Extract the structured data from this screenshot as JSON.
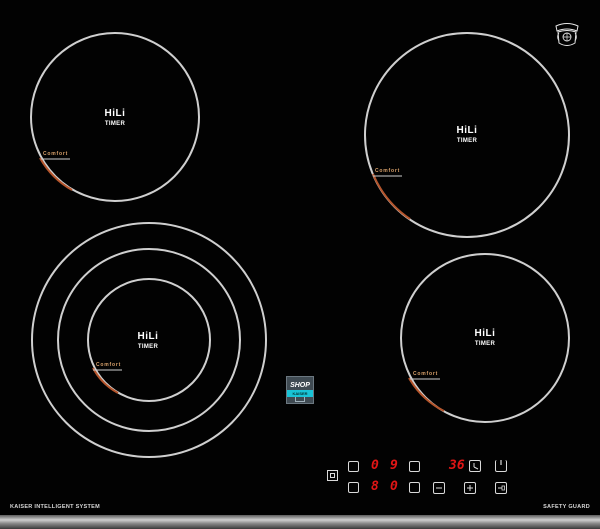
{
  "zones": [
    {
      "brand": "HiLi",
      "sub": "TIMER",
      "comfort": "Comfort"
    },
    {
      "brand": "HiLi",
      "sub": "TIMER",
      "comfort": "Comfort"
    },
    {
      "brand": "HiLi",
      "sub": "TIMER",
      "comfort": "Comfort"
    },
    {
      "brand": "HiLi",
      "sub": "TIMER",
      "comfort": "Comfort"
    }
  ],
  "logo": {
    "text": "Kaiser",
    "icon": "kaiser-crest-logo"
  },
  "shop_badge": {
    "top": "SHOP",
    "band": "KAISER"
  },
  "footer": {
    "left": "KAISER INTELLIGENT SYSTEM",
    "right": "SAFETY GUARD"
  },
  "controls": {
    "row1_digit_a": "0",
    "row1_digit_b": "9",
    "row1_timer": "36",
    "row2_digit_a": "8",
    "row2_digit_b": "0"
  },
  "colors": {
    "background": "#020202",
    "ring": "#cfcfcf",
    "comfort_marker": "#d7a06a",
    "display_red": "#e01515"
  }
}
